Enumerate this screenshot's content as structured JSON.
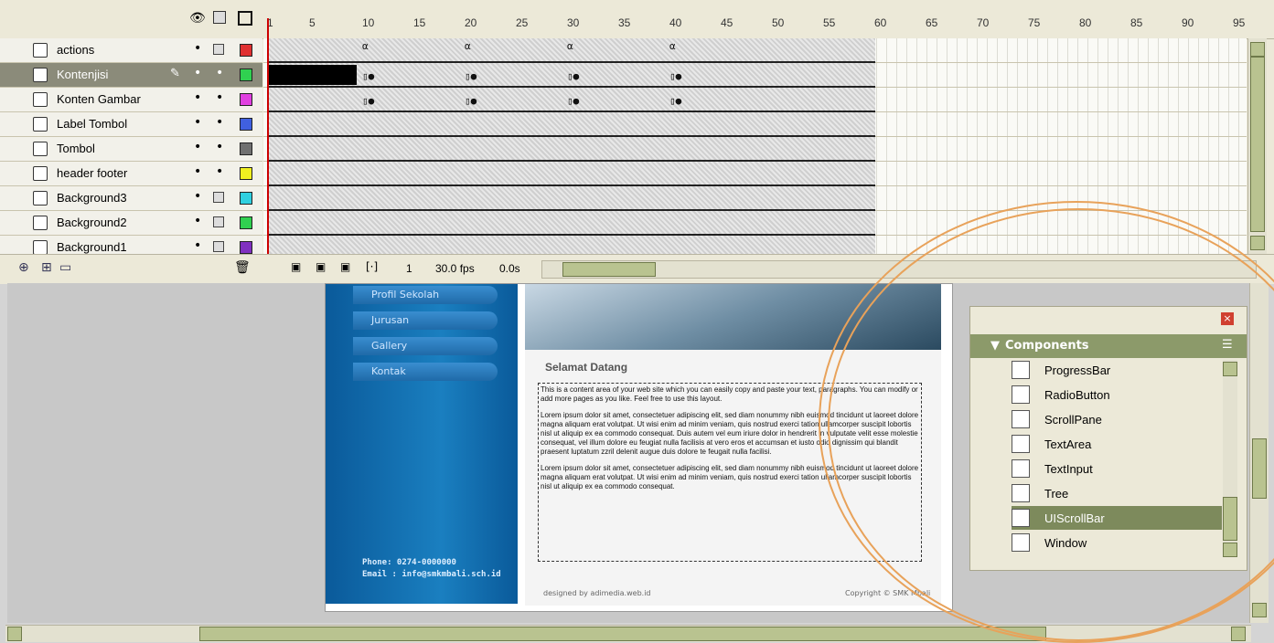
{
  "timeline": {
    "ruler_ticks": [
      "1",
      "5",
      "10",
      "15",
      "20",
      "25",
      "30",
      "35",
      "40",
      "45",
      "50",
      "55",
      "60",
      "65",
      "70",
      "75",
      "80",
      "85",
      "90",
      "95"
    ],
    "layers": [
      {
        "name": "actions",
        "color": "#e03030",
        "locked": true
      },
      {
        "name": "Kontenjisi",
        "color": "#30d050",
        "locked": false,
        "selected": true
      },
      {
        "name": "Konten Gambar",
        "color": "#e040e0",
        "locked": false
      },
      {
        "name": "Label Tombol",
        "color": "#4060e0",
        "locked": false
      },
      {
        "name": "Tombol",
        "color": "#707070",
        "locked": false
      },
      {
        "name": "header footer",
        "color": "#f0f020",
        "locked": false
      },
      {
        "name": "Background3",
        "color": "#30d0e0",
        "locked": true
      },
      {
        "name": "Background2",
        "color": "#30d050",
        "locked": true
      },
      {
        "name": "Background1",
        "color": "#8030c0",
        "locked": true
      }
    ],
    "footer": {
      "current_frame": "1",
      "fps": "30.0 fps",
      "time": "0.0s"
    }
  },
  "site": {
    "menu": [
      "Profil Sekolah",
      "Jurusan",
      "Gallery",
      "Kontak"
    ],
    "welcome": "Selamat Datang",
    "para1": "This is a content area of your web site which you can easily copy and paste your text, paragraphs. You can modify or add more pages as you like. Feel free to use this layout.",
    "para2": "Lorem ipsum dolor sit amet, consectetuer adipiscing elit, sed diam nonummy nibh euismod tincidunt ut laoreet dolore magna aliquam erat volutpat. Ut wisi enim ad minim veniam, quis nostrud exerci tation ullamcorper suscipit lobortis nisl ut aliquip ex ea commodo consequat. Duis autem vel eum iriure dolor in hendrerit in vulputate velit esse molestie consequat, vel illum dolore eu feugiat nulla facilisis at vero eros et accumsan et iusto odio dignissim qui blandit praesent luptatum zzril delenit augue duis dolore te feugait nulla facilisi.",
    "para3": "Lorem ipsum dolor sit amet, consectetuer adipiscing elit, sed diam nonummy nibh euismod tincidunt ut laoreet dolore magna aliquam erat volutpat. Ut wisi enim ad minim veniam, quis nostrud exerci tation ullamcorper suscipit lobortis nisl ut aliquip ex ea commodo consequat.",
    "phone": "Phone: 0274-0000000",
    "email": "Email : info@smkmbali.sch.id",
    "designed": "designed by adimedia.web.id",
    "copyright": "Copyright © SMK Mbali"
  },
  "components": {
    "title": "Components",
    "items": [
      {
        "label": "ProgressBar",
        "selected": false
      },
      {
        "label": "RadioButton",
        "selected": false
      },
      {
        "label": "ScrollPane",
        "selected": false
      },
      {
        "label": "TextArea",
        "selected": false
      },
      {
        "label": "TextInput",
        "selected": false
      },
      {
        "label": "Tree",
        "selected": false
      },
      {
        "label": "UIScrollBar",
        "selected": true
      },
      {
        "label": "Window",
        "selected": false
      }
    ]
  }
}
